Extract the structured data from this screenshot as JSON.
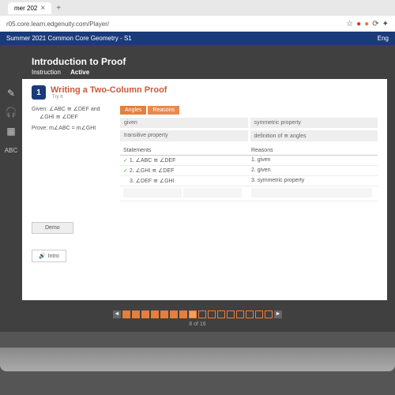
{
  "browser": {
    "tab_title": "mer 202",
    "url": "r05.core.learn.edgenuity.com/Player/"
  },
  "blue_bar": {
    "left": "Summer 2021 Common Core Geometry - S1",
    "right": "Eng"
  },
  "header": {
    "title": "Introduction to Proof",
    "sub_instruction": "Instruction",
    "sub_active": "Active"
  },
  "lesson": {
    "icon_text": "1",
    "title": "Writing a Two-Column Proof",
    "sub": "Try It"
  },
  "given_prove": {
    "given_line1": "Given: ∠ABC ≅ ∠DEF and",
    "given_line2": "∠GHI ≅ ∠DEF",
    "prove": "Prove: m∠ABC = m∠GHI"
  },
  "tags": {
    "angles": "Angles",
    "reasons": "Reasons"
  },
  "reason_bank": {
    "r1": "given",
    "r2": "symmetric property",
    "r3": "transitive property",
    "r4": "definition of ≅ angles"
  },
  "proof_headers": {
    "statements": "Statements",
    "reasons": "Reasons"
  },
  "proof_rows": [
    {
      "stmt": "1. ∠ABC ≅ ∠DEF",
      "reason": "1. given",
      "checked": true
    },
    {
      "stmt": "2. ∠GHI ≅ ∠DEF",
      "reason": "2. given",
      "checked": true
    },
    {
      "stmt": "3. ∠DEF ≅ ∠GHI",
      "reason": "3. symmetric property",
      "checked": false
    }
  ],
  "buttons": {
    "demo": "Demo",
    "intro": "Intro"
  },
  "nav": {
    "page_text": "8 of 16",
    "boxes": [
      1,
      1,
      1,
      1,
      1,
      1,
      1,
      2,
      0,
      0,
      0,
      0,
      0,
      0,
      0,
      0
    ]
  }
}
